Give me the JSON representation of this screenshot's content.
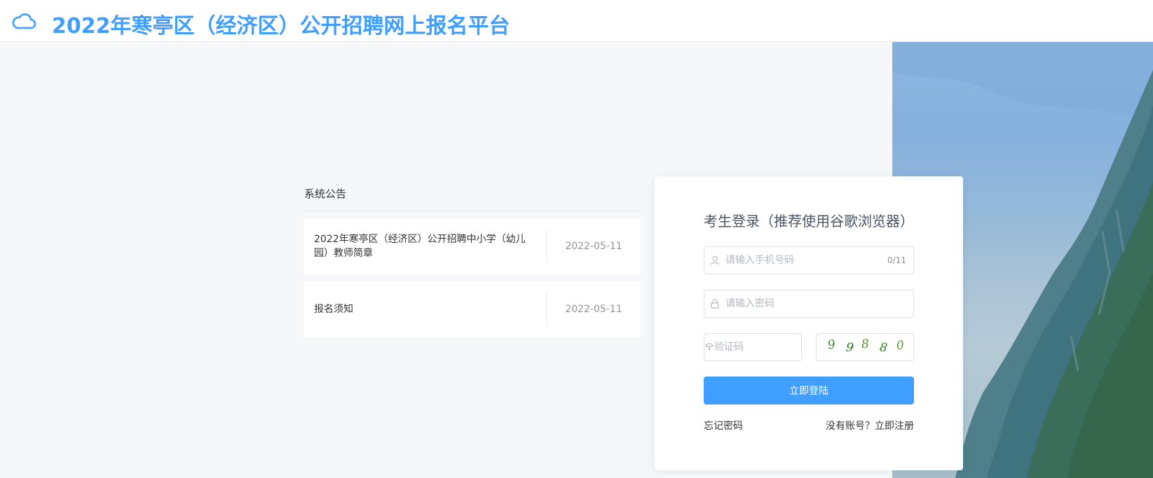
{
  "header": {
    "title": "2022年寒亭区（经济区）公开招聘网上报名平台",
    "logo_icon": "cloud-icon",
    "brand_color": "#409eff"
  },
  "notice": {
    "title": "系统公告",
    "items": [
      {
        "title": "2022年寒亭区（经济区）公开招聘中小学（幼儿园）教师简章",
        "date": "2022-05-11"
      },
      {
        "title": "报名须知",
        "date": "2022-05-11"
      }
    ]
  },
  "login": {
    "title": "考生登录（推荐使用谷歌浏览器）",
    "phone": {
      "placeholder": "请输入手机号码",
      "counter": "0/11",
      "icon": "user-icon"
    },
    "password": {
      "placeholder": "请输入密码",
      "icon": "lock-icon"
    },
    "captcha": {
      "placeholder": "验证码",
      "icon": "key-icon",
      "code": [
        "9",
        "9",
        "8",
        "8",
        "0"
      ]
    },
    "submit_label": "立即登陆",
    "forgot_label": "忘记密码",
    "register_label": "没有账号？立即注册"
  }
}
